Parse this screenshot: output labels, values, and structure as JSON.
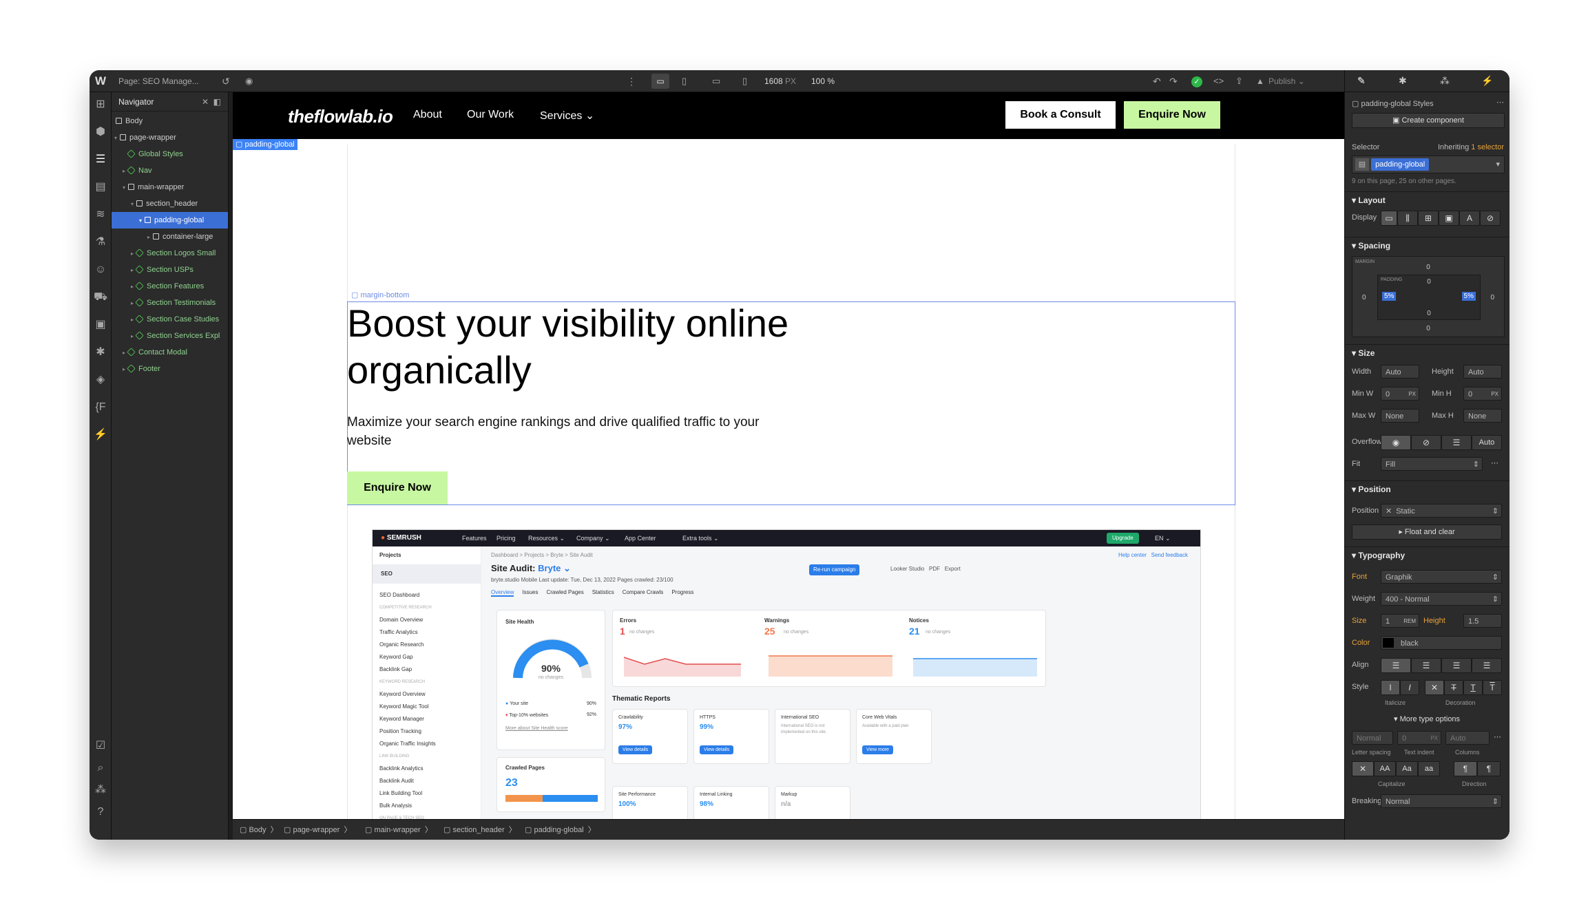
{
  "topbar": {
    "page_label": "Page: SEO Manage...",
    "width_value": "1608",
    "width_unit": "PX",
    "zoom": "100 %",
    "publish_label": "Publish"
  },
  "navigator": {
    "title": "Navigator",
    "items": [
      {
        "label": "Body"
      },
      {
        "label": "page-wrapper"
      },
      {
        "label": "Global Styles"
      },
      {
        "label": "Nav"
      },
      {
        "label": "main-wrapper"
      },
      {
        "label": "section_header"
      },
      {
        "label": "padding-global"
      },
      {
        "label": "container-large"
      },
      {
        "label": "Section Logos Small"
      },
      {
        "label": "Section USPs"
      },
      {
        "label": "Section Features"
      },
      {
        "label": "Section Testimonials"
      },
      {
        "label": "Section Case Studies"
      },
      {
        "label": "Section Services Expl"
      },
      {
        "label": "Contact Modal"
      },
      {
        "label": "Footer"
      }
    ]
  },
  "site": {
    "logo": "theflowlab.io",
    "nav_links": [
      "About",
      "Our Work",
      "Services"
    ],
    "services_caret": "⌄",
    "consult_btn": "Book a Consult",
    "enquire_btn": "Enquire Now",
    "selected_tag": "padding-global",
    "margin_tag": "margin-bottom",
    "hero_title": "Boost your visibility online organically",
    "hero_sub": "Maximize your search engine rankings and drive qualified traffic to your website",
    "hero_btn": "Enquire Now"
  },
  "semrush": {
    "brand": "SEMRUSH",
    "top_links": [
      "Features",
      "Pricing",
      "Resources ⌄",
      "Company ⌄",
      "App Center",
      "Extra tools ⌄"
    ],
    "upgrade": "Upgrade",
    "lang": "EN ⌄",
    "projects": "Projects",
    "seo": "SEO",
    "sidebar": [
      "SEO Dashboard",
      "COMPETITIVE RESEARCH",
      "Domain Overview",
      "Traffic Analytics",
      "Organic Research",
      "Keyword Gap",
      "Backlink Gap",
      "KEYWORD RESEARCH",
      "Keyword Overview",
      "Keyword Magic Tool",
      "Keyword Manager",
      "Position Tracking",
      "Organic Traffic Insights",
      "LINK BUILDING",
      "Backlink Analytics",
      "Backlink Audit",
      "Link Building Tool",
      "Bulk Analysis",
      "ON PAGE & TECH SEO"
    ],
    "crumbs": "Dashboard  >  Projects  >  Bryte  >  Site Audit",
    "help": "Help center",
    "feedback": "Send feedback",
    "title": "Site Audit:",
    "title_project": "Bryte ⌄",
    "meta": "bryte.studio    Mobile    Last update: Tue, Dec 13, 2022    Pages crawled: 23/100",
    "rerun": "Re-run campaign",
    "looker": "Looker Studio",
    "pdf": "PDF",
    "export": "Export",
    "tabs": [
      "Overview",
      "Issues",
      "Crawled Pages",
      "Statistics",
      "Compare Crawls",
      "Progress"
    ],
    "health_title": "Site Health",
    "health_value": "90%",
    "health_sub": "no changes",
    "your_site": "Your site",
    "your_site_val": "90%",
    "top10": "Top-10% websites",
    "top10_val": "92%",
    "more_health": "More about Site Health score",
    "errors_label": "Errors",
    "errors_value": "1",
    "warnings_label": "Warnings",
    "warnings_value": "25",
    "notices_label": "Notices",
    "notices_value": "21",
    "no_changes": "no changes",
    "thematic": "Thematic Reports",
    "crawled_title": "Crawled Pages",
    "crawled_value": "23",
    "reports": [
      {
        "name": "Crawlability",
        "value": "97%",
        "btn": "View details"
      },
      {
        "name": "HTTPS",
        "value": "99%",
        "btn": "View details"
      },
      {
        "name": "International SEO",
        "value": "International SEO is not implemented on this site.",
        "btn": ""
      },
      {
        "name": "Core Web Vitals",
        "value": "Available with a paid plan",
        "btn": "View more"
      },
      {
        "name": "Site Performance",
        "value": "100%",
        "btn": ""
      },
      {
        "name": "Internal Linking",
        "value": "98%",
        "btn": ""
      },
      {
        "name": "Markup",
        "value": "n/a",
        "btn": ""
      }
    ]
  },
  "breadcrumb": [
    "Body",
    "page-wrapper",
    "main-wrapper",
    "section_header",
    "padding-global"
  ],
  "style_panel": {
    "selector_name": "padding-global Styles",
    "create_component": "Create component",
    "selector_label": "Selector",
    "inheriting": "Inheriting",
    "inheriting_count": "1 selector",
    "selector_chip": "padding-global",
    "usage": "9 on this page, 25 on other pages.",
    "layout": "Layout",
    "display": "Display",
    "spacing": "Spacing",
    "margin": "MARGIN",
    "padding": "PADDING",
    "margin_vals": [
      "0",
      "0",
      "0",
      "0"
    ],
    "padding_vals": [
      "0",
      "5%",
      "0",
      "5%"
    ],
    "size": "Size",
    "width": "Width",
    "width_val": "Auto",
    "height": "Height",
    "height_val": "Auto",
    "minw": "Min W",
    "minw_val": "0",
    "minh": "Min H",
    "minh_val": "0",
    "maxw": "Max W",
    "maxw_val": "None",
    "maxh": "Max H",
    "maxh_val": "None",
    "unit_px": "PX",
    "overflow": "Overflow",
    "overflow_auto": "Auto",
    "fit": "Fit",
    "fit_val": "Fill",
    "position": "Position",
    "position_val": "Static",
    "float_clear": "Float and clear",
    "typography": "Typography",
    "font": "Font",
    "font_val": "Graphik",
    "weight": "Weight",
    "weight_val": "400 - Normal",
    "size_lbl": "Size",
    "size_val": "1",
    "size_unit": "REM",
    "lh_lbl": "Height",
    "lh_val": "1.5",
    "color": "Color",
    "color_val": "black",
    "align": "Align",
    "style": "Style",
    "italicize": "Italicize",
    "decoration": "Decoration",
    "more_type": "More type options",
    "letter_spacing": "Letter spacing",
    "ls_val": "Normal",
    "text_indent": "Text indent",
    "ti_val": "0",
    "columns": "Columns",
    "col_val": "Auto",
    "capitalize": "Capitalize",
    "direction": "Direction",
    "breaking": "Breaking",
    "breaking_val": "Normal"
  },
  "colors": {
    "accent_green": "#c8f7a2",
    "select_blue": "#3b6fd6",
    "panel_bg": "#2b2b2b",
    "orange": "#e8a33a"
  }
}
